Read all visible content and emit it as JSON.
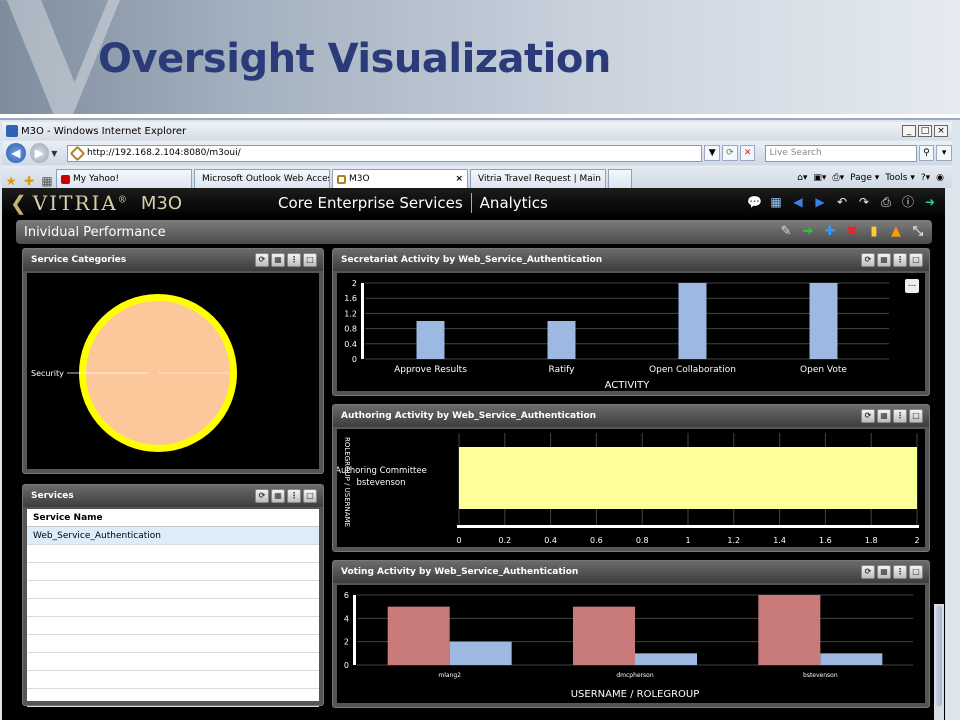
{
  "slide": {
    "logo_letter": "V",
    "title": "Oversight Visualization"
  },
  "browser": {
    "window_title": "M3O - Windows Internet Explorer",
    "url": "http://192.168.2.104:8080/m3oui/",
    "search_placeholder": "Live Search",
    "tabs": [
      {
        "label": "My Yahoo!"
      },
      {
        "label": "Microsoft Outlook Web Access"
      },
      {
        "label": "M3O",
        "active": true
      },
      {
        "label": "Vitria Travel Request | Main"
      }
    ],
    "commands": {
      "page": "Page",
      "tools": "Tools"
    }
  },
  "app": {
    "brand": "VITRIA",
    "registered": "®",
    "product": "M3O",
    "title_left": "Core Enterprise Services",
    "title_right": "Analytics",
    "perf_title": "Inividual Performance"
  },
  "panels": {
    "service_categories": {
      "title": "Service Categories",
      "slice_label": "Security"
    },
    "secretariat": {
      "title": "Secretariat Activity by Web_Service_Authentication",
      "more_label": "..."
    },
    "authoring": {
      "title": "Authoring Activity by Web_Service_Authentication"
    },
    "voting": {
      "title": "Voting Activity by Web_Service_Authentication"
    },
    "services": {
      "title": "Services",
      "column": "Service Name",
      "rows": [
        "Web_Service_Authentication"
      ]
    }
  },
  "colors": {
    "pie_fill": "#fcc79a",
    "pie_ring": "#ffff00",
    "bar_blue": "#9db9e2",
    "bar_yellow": "#ffff99",
    "bar_red": "#c97b7b"
  },
  "chart_data": [
    {
      "type": "pie",
      "categories": [
        "Security"
      ],
      "values": [
        1
      ]
    },
    {
      "type": "bar",
      "categories": [
        "Approve Results",
        "Ratify",
        "Open Collaboration",
        "Open Vote"
      ],
      "values": [
        1,
        1,
        2,
        2
      ],
      "xlabel": "ACTIVITY",
      "ylabel": "",
      "ylim": [
        0,
        2
      ],
      "yticks": [
        "0",
        "0.4",
        "0.8",
        "1.2",
        "1.6",
        "2"
      ],
      "grid": true
    },
    {
      "type": "bar",
      "orientation": "horizontal",
      "categories": [
        "Authoring Committee\nbstevenson"
      ],
      "category_lines": [
        "Authoring Committee",
        "bstevenson"
      ],
      "values": [
        2
      ],
      "ylabel": "ROLEGROUP / USERNAME",
      "xlim": [
        0,
        2
      ],
      "xticks": [
        "0",
        "0.2",
        "0.4",
        "0.6",
        "0.8",
        "1",
        "1.2",
        "1.4",
        "1.6",
        "1.8",
        "2"
      ],
      "grid": true
    },
    {
      "type": "bar",
      "categories": [
        "mlang2",
        "dmcpherson",
        "bstevenson"
      ],
      "series": [
        {
          "values": [
            5,
            5,
            6
          ]
        },
        {
          "values": [
            2,
            1,
            1
          ]
        }
      ],
      "xlabel": "USERNAME / ROLEGROUP",
      "ylim": [
        0,
        6
      ],
      "yticks": [
        "0",
        "2",
        "4",
        "6"
      ],
      "grid": true
    }
  ]
}
